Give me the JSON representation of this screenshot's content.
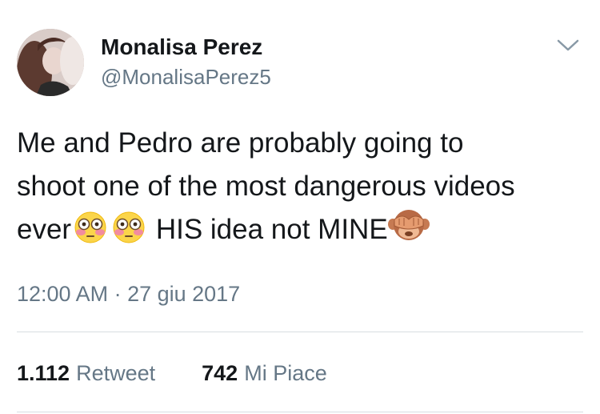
{
  "author": {
    "name": "Monalisa Perez",
    "handle": "@MonalisaPerez5"
  },
  "tweet": {
    "text_line1": "Me and Pedro are probably going to",
    "text_line2": "shoot one of the most dangerous videos",
    "text_line3_start": "ever",
    "text_line3_middle": " HIS idea not MINE",
    "emojis": [
      "flushed-face",
      "flushed-face",
      "see-no-evil-monkey"
    ]
  },
  "meta": {
    "timestamp": "12:00 AM · 27 giu 2017"
  },
  "stats": {
    "retweets_count": "1.112",
    "retweets_label": "Retweet",
    "likes_count": "742",
    "likes_label": "Mi Piace"
  },
  "icons": {
    "menu": "chevron-down-icon"
  },
  "colors": {
    "text": "#14171a",
    "secondary": "#657786",
    "divider": "#d8dde1"
  }
}
